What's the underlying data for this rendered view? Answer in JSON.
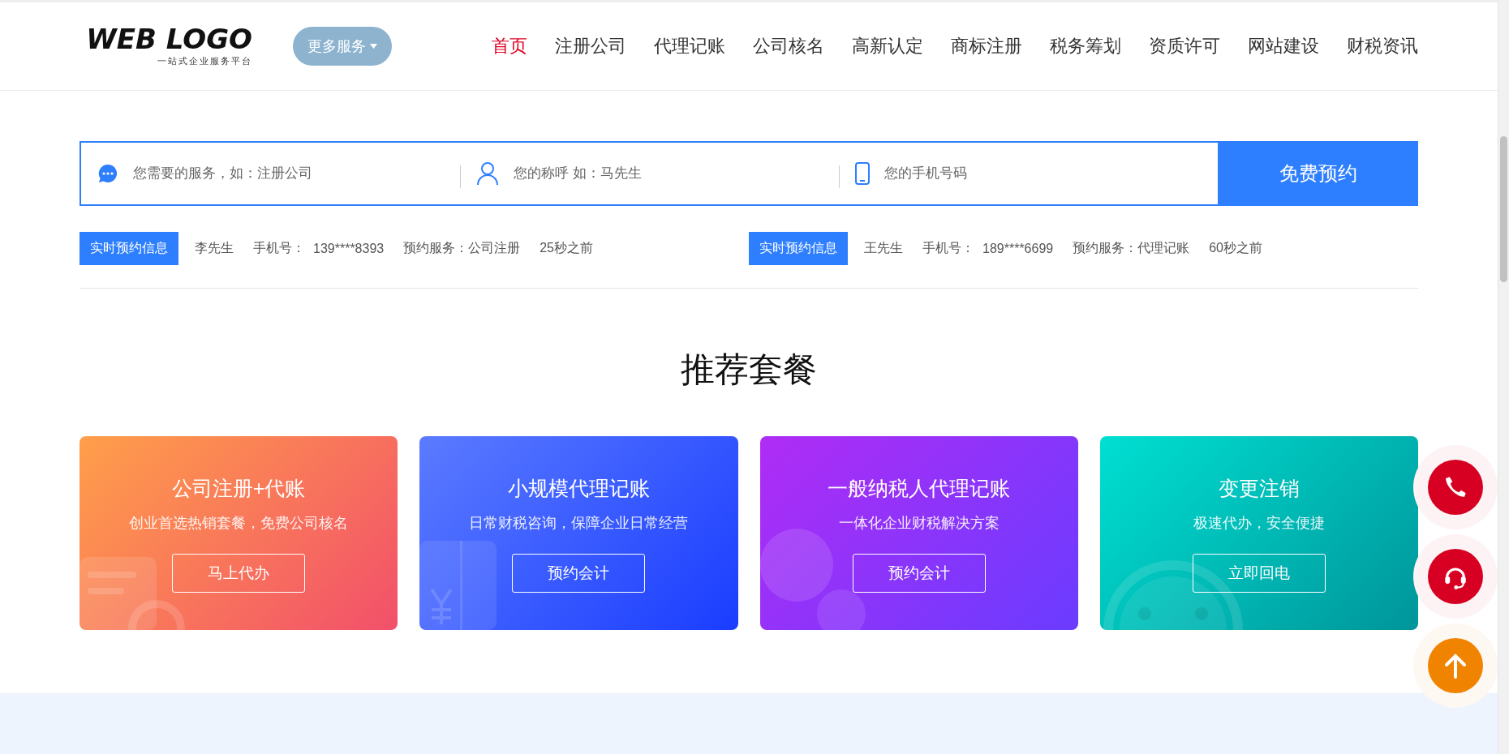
{
  "header": {
    "logo": {
      "title": "WEB LOGO",
      "tagline": "一站式企业服务平台"
    },
    "more_button": "更多服务",
    "nav": [
      {
        "label": "首页",
        "selected": true
      },
      {
        "label": "注册公司",
        "selected": false
      },
      {
        "label": "代理记账",
        "selected": false
      },
      {
        "label": "公司核名",
        "selected": false
      },
      {
        "label": "高新认定",
        "selected": false
      },
      {
        "label": "商标注册",
        "selected": false
      },
      {
        "label": "税务筹划",
        "selected": false
      },
      {
        "label": "资质许可",
        "selected": false
      },
      {
        "label": "网站建设",
        "selected": false
      },
      {
        "label": "财税资讯",
        "selected": false
      }
    ]
  },
  "booking_form": {
    "fields": [
      {
        "kind": "chat",
        "placeholder": "您需要的服务，如：注册公司"
      },
      {
        "kind": "person",
        "placeholder": "您的称呼 如：马先生"
      },
      {
        "kind": "phone",
        "placeholder": "您的手机号码"
      }
    ],
    "submit": "免费预约"
  },
  "realtime": [
    {
      "badge": "实时预约信息",
      "name": "李先生",
      "phone_label": "手机号：",
      "phone": "139****8393",
      "service": "预约服务：公司注册",
      "time": "25秒之前"
    },
    {
      "badge": "实时预约信息",
      "name": "王先生",
      "phone_label": "手机号：",
      "phone": "189****6699",
      "service": "预约服务：代理记账",
      "time": "60秒之前"
    }
  ],
  "packages": {
    "title": "推荐套餐",
    "cards": [
      {
        "title": "公司注册+代账",
        "subtitle": "创业首选热销套餐，免费公司核名",
        "button": "马上代办"
      },
      {
        "title": "小规模代理记账",
        "subtitle": "日常财税咨询，保障企业日常经营",
        "button": "预约会计"
      },
      {
        "title": "一般纳税人代理记账",
        "subtitle": "一体化企业财税解决方案",
        "button": "预约会计"
      },
      {
        "title": "变更注销",
        "subtitle": "极速代办，安全便捷",
        "button": "立即回电"
      }
    ]
  },
  "float_buttons": [
    {
      "kind": "phone"
    },
    {
      "kind": "headset"
    },
    {
      "kind": "top"
    }
  ]
}
